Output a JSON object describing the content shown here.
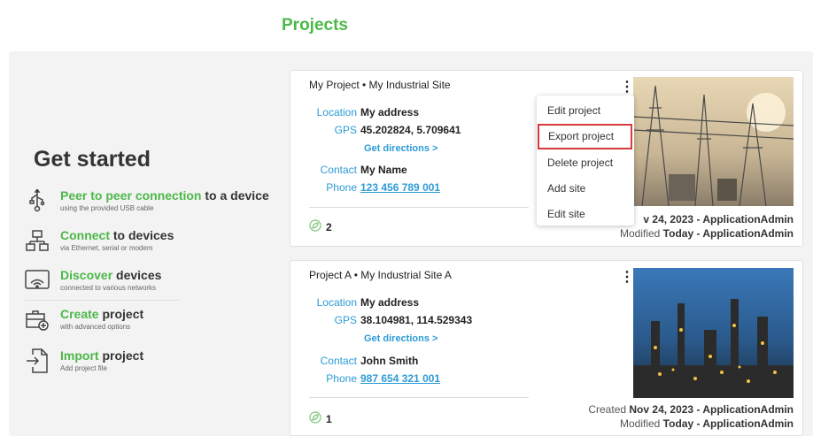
{
  "header": {
    "title": "Projects"
  },
  "get_started": {
    "title": "Get started",
    "items": [
      {
        "accent": "Peer to peer connection",
        "rest": " to a device",
        "sub": "using the provided USB cable",
        "icon": "usb-icon"
      },
      {
        "accent": "Connect",
        "rest": " to devices",
        "sub": "via Ethernet, serial or modem",
        "icon": "network-icon"
      },
      {
        "accent": "Discover",
        "rest": " devices",
        "sub": "connected to various networks",
        "icon": "wifi-discover-icon"
      },
      {
        "accent": "Create",
        "rest": " project",
        "sub": "with advanced options",
        "icon": "create-project-icon"
      },
      {
        "accent": "Import",
        "rest": " project",
        "sub": "Add project file",
        "icon": "import-icon"
      }
    ]
  },
  "projects": [
    {
      "title": "My Project • My Industrial Site",
      "location_label": "Location",
      "location": "My address",
      "gps_label": "GPS",
      "gps": "45.202824, 5.709641",
      "directions": "Get directions >",
      "contact_label": "Contact",
      "contact": "My Name",
      "phone_label": "Phone",
      "phone": "123 456 789 001",
      "sites": "2",
      "created_prefix": "",
      "created_value": "v 24, 2023 - ApplicationAdmin",
      "modified_prefix": "Modified",
      "modified_value": "Today - ApplicationAdmin"
    },
    {
      "title": "Project A • My Industrial Site A",
      "location_label": "Location",
      "location": "My address",
      "gps_label": "GPS",
      "gps": "38.104981, 114.529343",
      "directions": "Get directions >",
      "contact_label": "Contact",
      "contact": "John Smith",
      "phone_label": "Phone",
      "phone": "987 654 321 001",
      "sites": "1",
      "created_prefix": "Created",
      "created_value": "Nov 24, 2023 - ApplicationAdmin",
      "modified_prefix": "Modified",
      "modified_value": "Today - ApplicationAdmin"
    }
  ],
  "context_menu": {
    "items": [
      "Edit project",
      "Export project",
      "Delete project",
      "Add site",
      "Edit site"
    ],
    "selected": "Export project"
  },
  "colors": {
    "accent": "#4cb848",
    "link": "#2d9bd6",
    "highlight": "#d63a3a"
  }
}
